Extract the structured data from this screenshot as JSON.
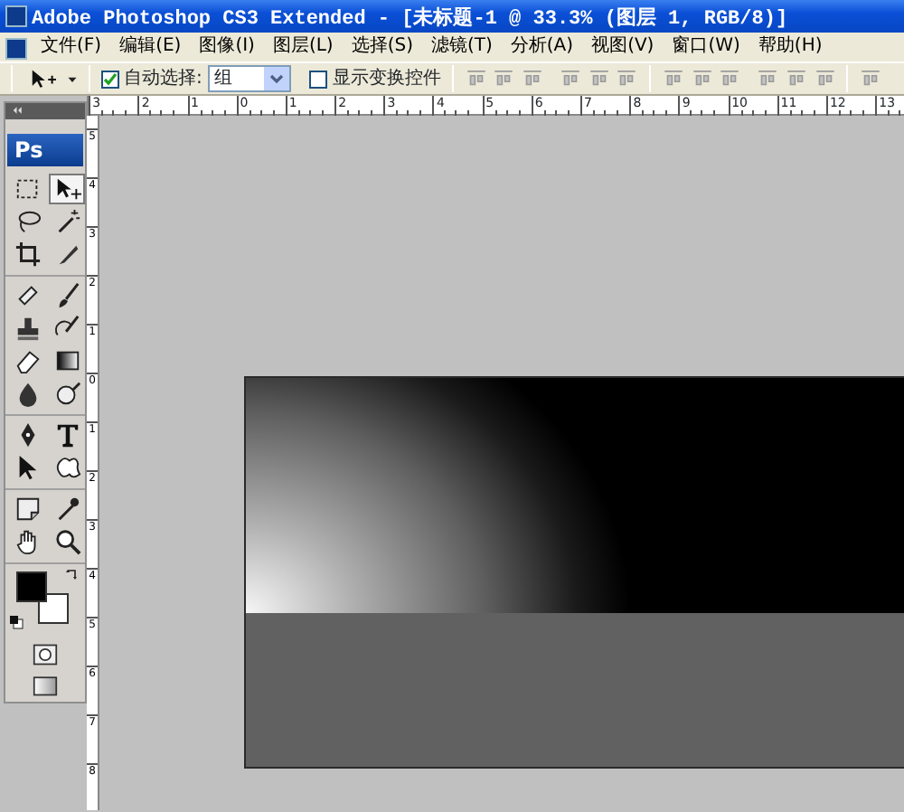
{
  "window": {
    "title": "Adobe Photoshop CS3 Extended - [未标题-1 @ 33.3% (图层 1, RGB/8)]"
  },
  "menu": [
    "文件(F)",
    "编辑(E)",
    "图像(I)",
    "图层(L)",
    "选择(S)",
    "滤镜(T)",
    "分析(A)",
    "视图(V)",
    "窗口(W)",
    "帮助(H)"
  ],
  "options_bar": {
    "auto_select": {
      "label": "自动选择:",
      "checked": true
    },
    "auto_select_target": {
      "value": "组"
    },
    "show_transform": {
      "label": "显示变换控件",
      "checked": false
    }
  },
  "toolbox": {
    "logo": "Ps",
    "tool_groups": [
      [
        {
          "kind": "marquee",
          "selected": false
        },
        {
          "kind": "move",
          "selected": true
        },
        {
          "kind": "lasso",
          "selected": false
        },
        {
          "kind": "wand",
          "selected": false
        },
        {
          "kind": "crop",
          "selected": false
        },
        {
          "kind": "slice",
          "selected": false
        }
      ],
      [
        {
          "kind": "healing",
          "selected": false
        },
        {
          "kind": "brush",
          "selected": false
        },
        {
          "kind": "stamp",
          "selected": false
        },
        {
          "kind": "history",
          "selected": false
        },
        {
          "kind": "eraser",
          "selected": false
        },
        {
          "kind": "gradient",
          "selected": false
        },
        {
          "kind": "blur",
          "selected": false
        },
        {
          "kind": "dodge",
          "selected": false
        }
      ],
      [
        {
          "kind": "pen",
          "selected": false
        },
        {
          "kind": "type",
          "selected": false
        },
        {
          "kind": "path",
          "selected": false
        },
        {
          "kind": "shape",
          "selected": false
        }
      ],
      [
        {
          "kind": "notes",
          "selected": false
        },
        {
          "kind": "eyedropper",
          "selected": false
        },
        {
          "kind": "hand",
          "selected": false
        },
        {
          "kind": "zoom",
          "selected": false
        }
      ]
    ],
    "swatches": [
      {
        "kind": "foreground",
        "color": "#000000"
      },
      {
        "kind": "background",
        "color": "#ffffff"
      }
    ]
  },
  "rulers": {
    "horizontal": [
      "3",
      "2",
      "1",
      "0",
      "1",
      "2",
      "3",
      "4",
      "5",
      "6",
      "7",
      "8",
      "9",
      "10",
      "11",
      "12",
      "13"
    ],
    "vertical": [
      "5",
      "4",
      "3",
      "2",
      "1",
      "0",
      "1",
      "2",
      "3",
      "4",
      "5",
      "6",
      "7",
      "8"
    ]
  }
}
